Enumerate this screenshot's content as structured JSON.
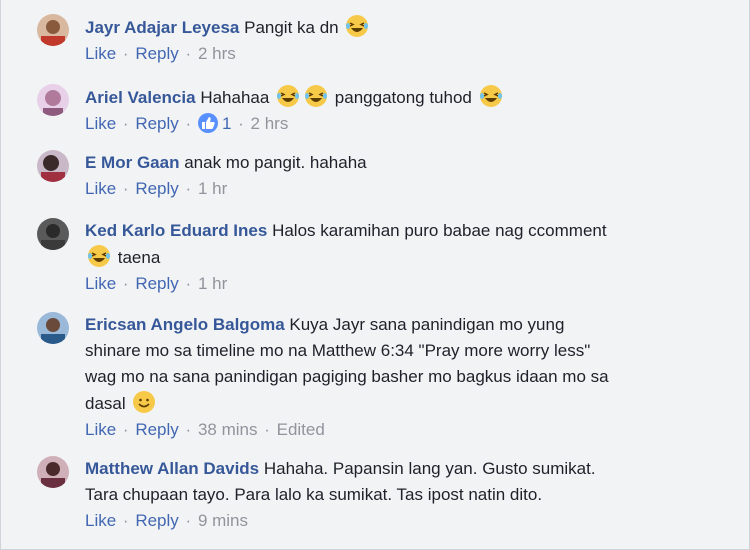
{
  "actions": {
    "like": "Like",
    "reply": "Reply",
    "separator": "·"
  },
  "comments": [
    {
      "name": "Jayr Adajar Leyesa",
      "text1": "Pangit ka dn",
      "time": "2 hrs"
    },
    {
      "name": "Ariel Valencia",
      "text1": "Hahahaa",
      "text2": "panggatong tuhod",
      "reactions": "1",
      "time": "2 hrs"
    },
    {
      "name": "E Mor Gaan",
      "text1": "anak mo pangit. hahaha",
      "time": "1 hr"
    },
    {
      "name": "Ked Karlo Eduard Ines",
      "text1": "Halos karamihan puro babae nag ccomment",
      "text2": "taena",
      "time": "1 hr"
    },
    {
      "name": "Ericsan Angelo Balgoma",
      "text1": "Kuya Jayr sana panindigan mo yung",
      "line2": "shinare mo sa timeline mo na Matthew 6:34 \"Pray more worry less\"",
      "line3": "wag mo na sana panindigan pagiging basher mo bagkus idaan mo sa",
      "line4": "dasal",
      "time": "38 mins",
      "edited": "Edited"
    },
    {
      "name": "Matthew Allan Davids",
      "text1": "Hahaha. Papansin lang yan. Gusto sumikat.",
      "line2": "Tara chupaan tayo. Para lalo ka sumikat. Tas ipost natin dito.",
      "time": "9 mins"
    }
  ],
  "colors": {
    "name": "#365899",
    "link": "#4267b2",
    "meta": "#90949c",
    "text": "#1d2129",
    "background": "#f2f3f5"
  }
}
